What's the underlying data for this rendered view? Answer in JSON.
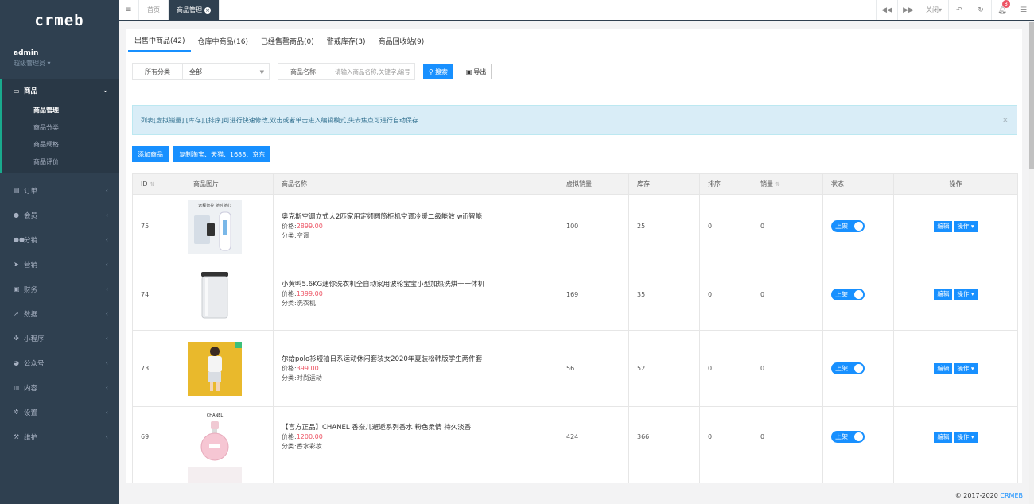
{
  "sidebar": {
    "logo": "crmeb",
    "user_name": "admin",
    "user_role": "超级管理员",
    "active_menu": {
      "label": "商品",
      "icon": "laptop-icon"
    },
    "submenu": [
      "商品管理",
      "商品分类",
      "商品规格",
      "商品评价"
    ],
    "menu": [
      {
        "label": "订单",
        "icon": "file-icon"
      },
      {
        "label": "会员",
        "icon": "user-icon"
      },
      {
        "label": "分销",
        "icon": "users-icon"
      },
      {
        "label": "营销",
        "icon": "paper-plane-icon"
      },
      {
        "label": "财务",
        "icon": "money-icon"
      },
      {
        "label": "数据",
        "icon": "line-chart-icon"
      },
      {
        "label": "小程序",
        "icon": "network-icon"
      },
      {
        "label": "公众号",
        "icon": "wechat-icon"
      },
      {
        "label": "内容",
        "icon": "book-icon"
      },
      {
        "label": "设置",
        "icon": "cog-icon"
      },
      {
        "label": "维护",
        "icon": "wrench-icon"
      }
    ]
  },
  "topbar": {
    "tabs": [
      "首页",
      "商品管理"
    ],
    "close_label": "关闭",
    "notification_count": "3"
  },
  "subtabs": [
    "出售中商品(42)",
    "仓库中商品(16)",
    "已经售罄商品(0)",
    "警戒库存(3)",
    "商品回收站(9)"
  ],
  "filters": {
    "category_label": "所有分类",
    "category_value": "全部",
    "name_label": "商品名称",
    "name_placeholder": "请输入商品名称,关键字,编号",
    "search_label": "搜索",
    "export_label": "导出"
  },
  "notice": "列表[虚拟销量],[库存],[排序]可进行快速修改,双击或者单击进入编辑模式,失去焦点可进行自动保存",
  "actions": {
    "add": "添加商品",
    "copy": "复制淘宝、天猫、1688、京东"
  },
  "table": {
    "headers": [
      "ID",
      "商品图片",
      "商品名称",
      "虚拟销量",
      "库存",
      "排序",
      "销量",
      "状态",
      "操作"
    ],
    "price_prefix": "价格:",
    "cat_prefix": "分类:",
    "status_label": "上架",
    "edit_label": "编辑",
    "op_label": "操作",
    "rows": [
      {
        "id": "75",
        "name": "奥克斯空调立式大2匹家用定频圆筒柜机空调冷暖二级能效 wifi智能",
        "price": "2899.00",
        "category": "空调",
        "virtual_sales": "100",
        "stock": "25",
        "sort": "0",
        "sales": "0",
        "image": "air-conditioner-image",
        "img_caption": "远程智控 随时随心"
      },
      {
        "id": "74",
        "name": "小黄鸭5.6KG迷你洗衣机全自动家用波轮宝宝小型加热洗烘干一体机",
        "price": "1399.00",
        "category": "洗衣机",
        "virtual_sales": "169",
        "stock": "35",
        "sort": "0",
        "sales": "0",
        "image": "washing-machine-image",
        "img_caption": ""
      },
      {
        "id": "73",
        "name": "尔给polo衫短袖日系运动休闲套装女2020年夏装松韩版学生两件套",
        "price": "399.00",
        "category": "时尚运动",
        "virtual_sales": "56",
        "stock": "52",
        "sort": "0",
        "sales": "0",
        "image": "fashion-outfit-image",
        "img_caption": ""
      },
      {
        "id": "69",
        "name": "【官方正品】CHANEL 香奈儿邂逅系列香水 粉色柔情 持久淡香",
        "price": "1200.00",
        "category": "香水彩妆",
        "virtual_sales": "424",
        "stock": "366",
        "sort": "0",
        "sales": "0",
        "image": "perfume-image",
        "img_caption": "CHANEL"
      }
    ]
  },
  "footer": {
    "copyright": "© 2017-2020 ",
    "brand": "CRMEB"
  }
}
